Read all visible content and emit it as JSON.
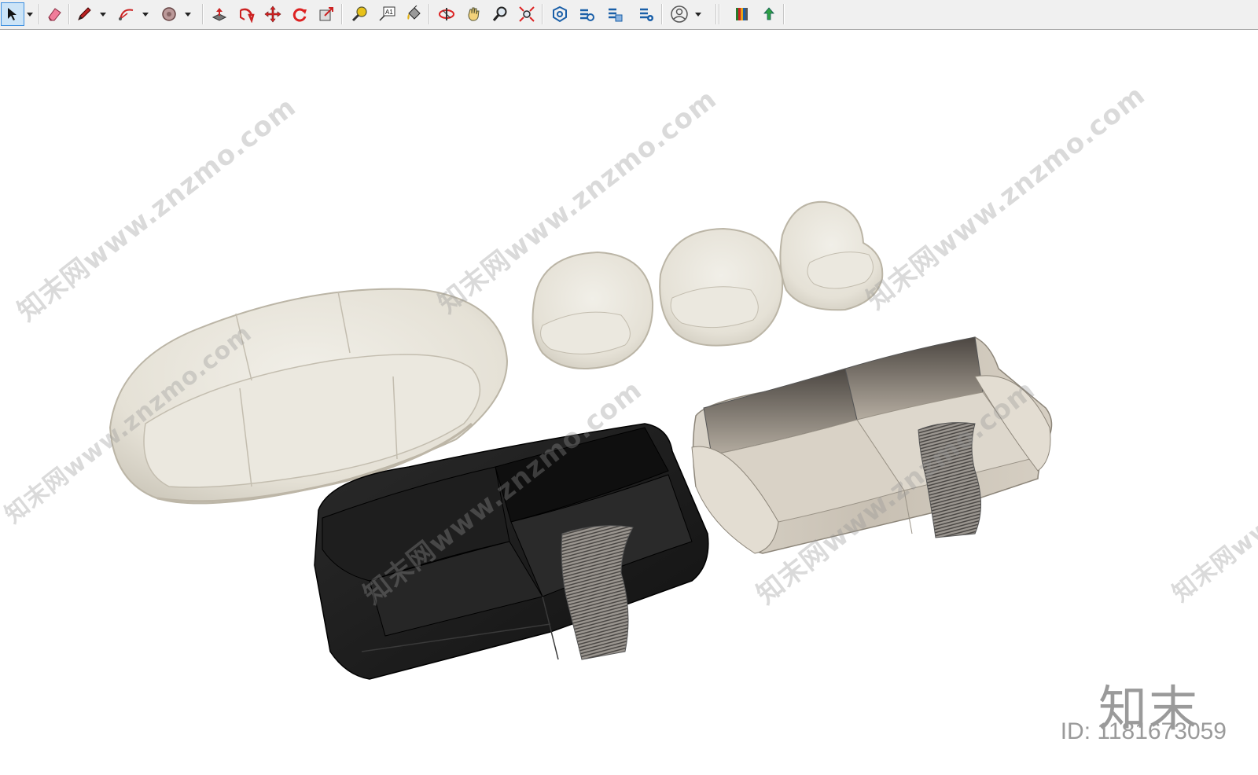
{
  "toolbar": {
    "tools": [
      {
        "name": "select-tool",
        "icon": "arrow-icon"
      },
      {
        "name": "eraser-tool",
        "icon": "eraser-icon"
      },
      {
        "name": "line-tool",
        "icon": "pencil-icon"
      },
      {
        "name": "arc-tool",
        "icon": "arc-icon"
      },
      {
        "name": "shapes-tool",
        "icon": "circle-icon"
      },
      {
        "name": "push-pull-tool",
        "icon": "push-pull-icon"
      },
      {
        "name": "follow-me-tool",
        "icon": "follow-me-icon"
      },
      {
        "name": "move-tool",
        "icon": "move-icon"
      },
      {
        "name": "rotate-tool",
        "icon": "rotate-icon"
      },
      {
        "name": "scale-tool",
        "icon": "scale-icon"
      },
      {
        "name": "tape-measure-tool",
        "icon": "tape-measure-icon"
      },
      {
        "name": "text-tool",
        "icon": "text-icon"
      },
      {
        "name": "paint-bucket-tool",
        "icon": "paint-bucket-icon"
      },
      {
        "name": "orbit-tool",
        "icon": "orbit-icon"
      },
      {
        "name": "pan-tool",
        "icon": "hand-icon"
      },
      {
        "name": "zoom-tool",
        "icon": "magnifier-icon"
      },
      {
        "name": "zoom-extents-tool",
        "icon": "zoom-extents-icon"
      },
      {
        "name": "3d-warehouse",
        "icon": "warehouse-icon"
      },
      {
        "name": "extension-warehouse",
        "icon": "extension-icon"
      },
      {
        "name": "layout-send",
        "icon": "layout-icon"
      },
      {
        "name": "extension-manager",
        "icon": "extension-manager-icon"
      },
      {
        "name": "account",
        "icon": "user-icon"
      },
      {
        "name": "style-builder",
        "icon": "color-bars-icon"
      },
      {
        "name": "upload",
        "icon": "green-arrow-icon"
      }
    ],
    "text_tool_glyph": "A1"
  },
  "watermarks": {
    "text": "知末网www.znzmo.com",
    "short_text": "知末网www.znzmo.com"
  },
  "brand": {
    "name": "知末",
    "id_label": "ID: 1181673059"
  },
  "colors": {
    "sofa_light": "#e9e6dd",
    "sofa_dark": "#1c1c1c",
    "sofa_taupe": "#cfc8bd",
    "blanket": "#8a8580"
  }
}
